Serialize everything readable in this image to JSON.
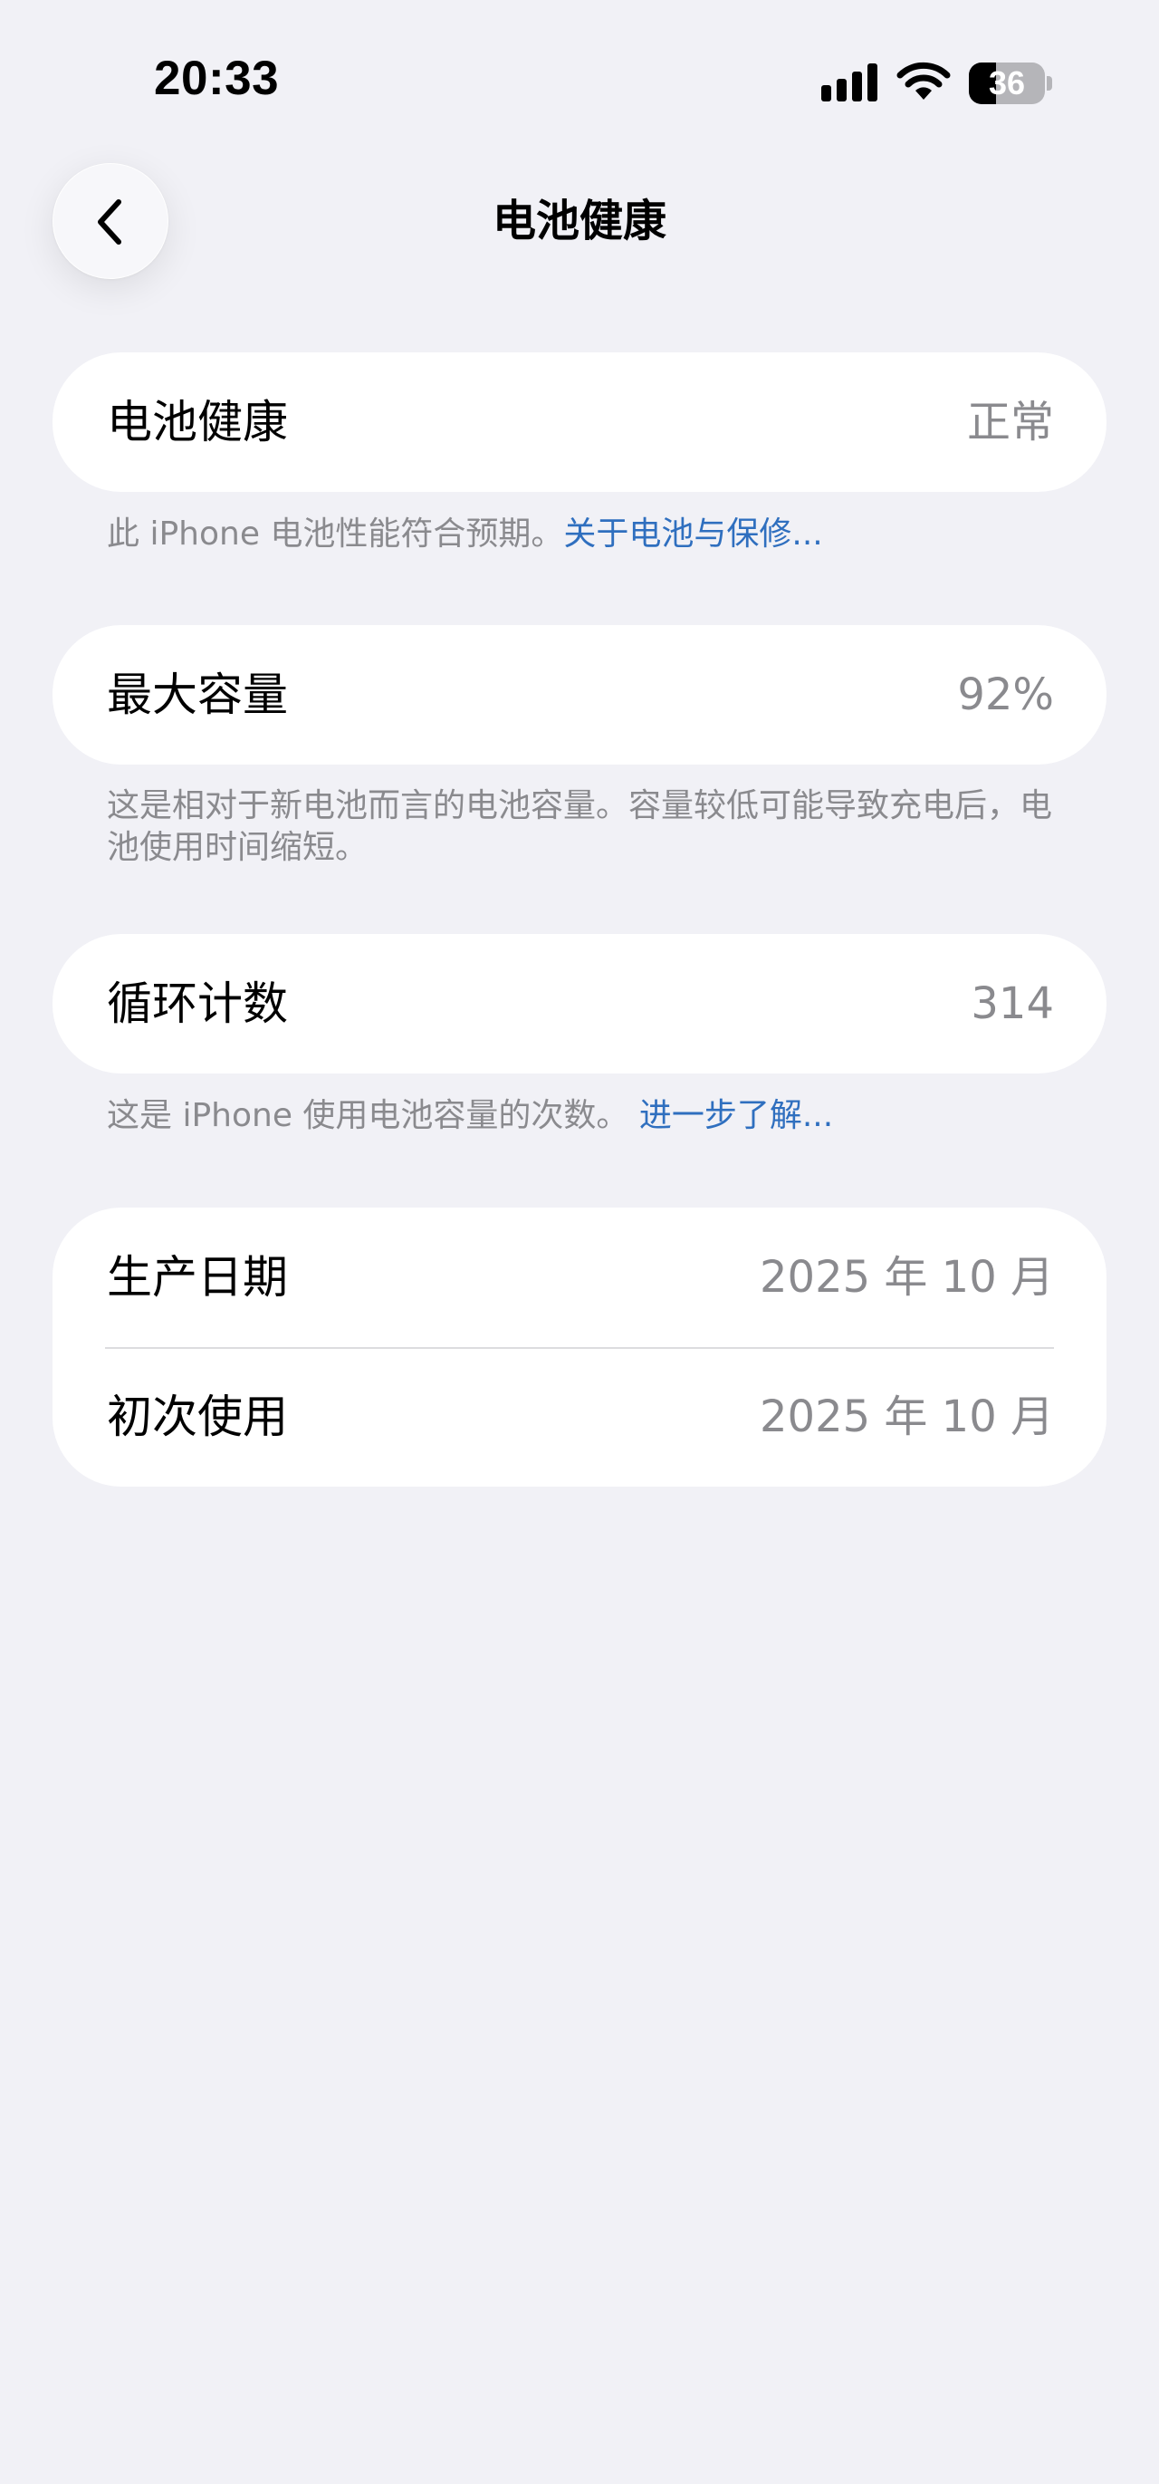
{
  "status_bar": {
    "time": "20:33",
    "battery_level": "36",
    "battery_fraction": 0.36,
    "icons": [
      "signal-icon",
      "wifi-icon",
      "battery-icon"
    ]
  },
  "nav": {
    "back_icon": "chevron-left-icon",
    "title": "电池健康"
  },
  "battery_health": {
    "label": "电池健康",
    "value": "正常",
    "footnote_text": "此 iPhone 电池性能符合预期。",
    "footnote_link": "关于电池与保修..."
  },
  "max_capacity": {
    "label": "最大容量",
    "value": "92%",
    "footnote_text": "这是相对于新电池而言的电池容量。容量较低可能导致充电后，电池使用时间缩短。"
  },
  "cycle_count": {
    "label": "循环计数",
    "value": "314",
    "footnote_text": "这是 iPhone 使用电池容量的次数。",
    "footnote_link": "进一步了解..."
  },
  "dates": {
    "manufacture_label": "生产日期",
    "manufacture_value": "2025 年 10 月",
    "first_use_label": "初次使用",
    "first_use_value": "2025 年 10 月"
  },
  "colors": {
    "background": "#f1f1f6",
    "card": "#ffffff",
    "secondary_text": "#8a8a8e",
    "link": "#2f6fbf"
  }
}
